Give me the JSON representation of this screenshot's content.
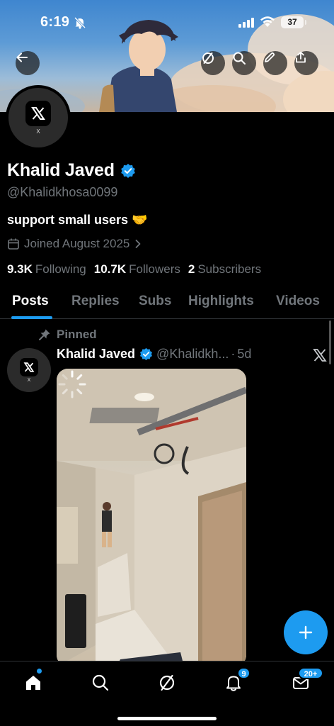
{
  "status_bar": {
    "time": "6:19",
    "battery": "37"
  },
  "header": {
    "back_icon": "arrow-left-icon",
    "actions": [
      "grok-icon",
      "search-icon",
      "edit-icon",
      "share-icon"
    ]
  },
  "profile": {
    "avatar_label": "X",
    "name": "Khalid Javed",
    "verified": true,
    "handle": "@Khalidkhosa0099",
    "bio": "support small users 🤝",
    "joined": "Joined August 2025",
    "stats": {
      "following_count": "9.3K",
      "following_label": "Following",
      "followers_count": "10.7K",
      "followers_label": "Followers",
      "subscribers_count": "2",
      "subscribers_label": "Subscribers"
    }
  },
  "tabs": [
    {
      "label": "Posts",
      "active": true
    },
    {
      "label": "Replies",
      "active": false
    },
    {
      "label": "Subs",
      "active": false
    },
    {
      "label": "Highlights",
      "active": false
    },
    {
      "label": "Videos",
      "active": false
    }
  ],
  "pinned_post": {
    "pinned_label": "Pinned",
    "author_name": "Khalid Javed",
    "author_handle": "@Khalidkh...",
    "separator": "·",
    "time": "5d",
    "avatar_label": "X",
    "media_type": "video"
  },
  "bottom_nav": {
    "items": [
      "home-icon",
      "search-icon",
      "grok-icon",
      "notifications-icon",
      "messages-icon"
    ],
    "notifications_badge": "9",
    "messages_badge": "20+"
  },
  "colors": {
    "accent": "#1d9bf0",
    "background": "#000000",
    "secondary_text": "#71767b"
  }
}
